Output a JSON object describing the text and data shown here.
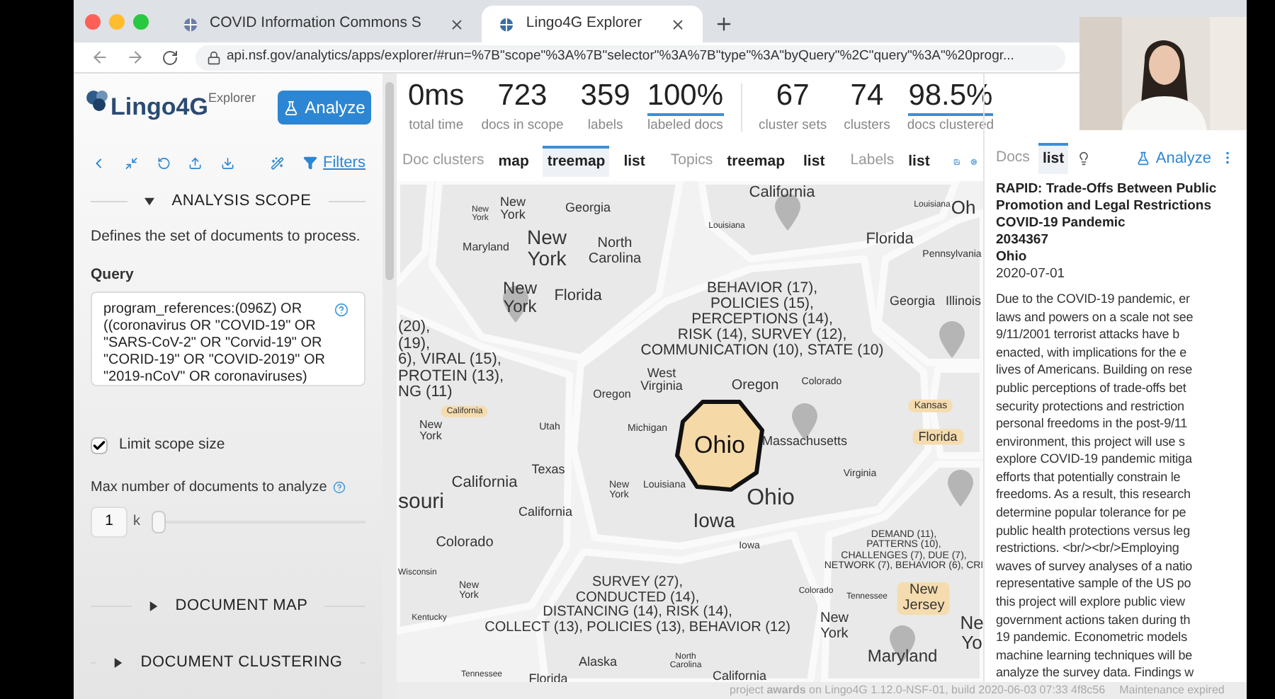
{
  "browser": {
    "tabs": [
      {
        "title": "COVID Information Commons S",
        "selected": false
      },
      {
        "title": "Lingo4G Explorer",
        "selected": true
      }
    ],
    "url": "api.nsf.gov/analytics/apps/explorer/#run=%7B\"scope\"%3A%7B\"selector\"%3A%7B\"type\"%3A\"byQuery\"%2C\"query\"%3A\"%20progr..."
  },
  "sidebar": {
    "logo": "Lingo4G",
    "logo_sup": "Explorer",
    "analyze": "Analyze",
    "filters": "Filters",
    "scope": {
      "title": "ANALYSIS SCOPE",
      "expanded": true,
      "description": "Defines the set of documents to process.",
      "query_label": "Query",
      "query": "program_references:(096Z) OR ((coronavirus OR \"COVID-19\" OR \"SARS-CoV-2\" OR \"Corvid-19\" OR \"CORID-19\" OR \"COVID-2019\" OR \"2019-nCoV\" OR coronaviruses)",
      "limit_label": "Limit scope size",
      "limit_checked": true,
      "max_label": "Max number of documents to analyze",
      "max_value": "1",
      "max_unit": "k",
      "level": 0
    },
    "sections": [
      {
        "title": "DOCUMENT MAP",
        "expanded": false
      },
      {
        "title": "DOCUMENT CLUSTERING",
        "expanded": false
      }
    ]
  },
  "stats": [
    {
      "value": "0ms",
      "label": "total time",
      "linked": false,
      "divider_before": false
    },
    {
      "value": "723",
      "label": "docs in scope",
      "linked": false,
      "divider_before": false
    },
    {
      "value": "359",
      "label": "labels",
      "linked": false,
      "divider_before": false
    },
    {
      "value": "100%",
      "label": "labeled docs",
      "linked": true,
      "divider_before": false
    },
    {
      "value": "67",
      "label": "cluster sets",
      "linked": false,
      "divider_before": true
    },
    {
      "value": "74",
      "label": "clusters",
      "linked": false,
      "divider_before": false
    },
    {
      "value": "98.5%",
      "label": "docs clustered",
      "linked": true,
      "divider_before": false
    }
  ],
  "views": [
    {
      "label": "Doc clusters",
      "options": [
        {
          "label": "map",
          "selected": false
        },
        {
          "label": "treemap",
          "selected": true
        },
        {
          "label": "list",
          "selected": false
        }
      ]
    },
    {
      "label": "Topics",
      "options": [
        {
          "label": "treemap",
          "selected": false
        },
        {
          "label": "list",
          "selected": false
        }
      ]
    },
    {
      "label": "Labels",
      "options": [
        {
          "label": "list",
          "selected": false
        }
      ]
    }
  ],
  "treemap": {
    "focus": "Ohio",
    "labels": [
      {
        "text": "New York",
        "highlighted": false
      },
      {
        "text": "New York",
        "highlighted": false
      },
      {
        "text": "Georgia",
        "highlighted": false
      },
      {
        "text": "Maryland",
        "highlighted": false
      },
      {
        "text": "New York",
        "highlighted": false
      },
      {
        "text": "North Carolina",
        "highlighted": false
      },
      {
        "text": "New York",
        "highlighted": false
      },
      {
        "text": "Florida",
        "highlighted": false
      },
      {
        "text": "California",
        "highlighted": false
      },
      {
        "text": "Louisiana",
        "highlighted": false
      },
      {
        "text": "Louisiana",
        "highlighted": false
      },
      {
        "text": "Oh",
        "highlighted": false
      },
      {
        "text": "Florida",
        "highlighted": false
      },
      {
        "text": "Pennsylvania",
        "highlighted": false
      },
      {
        "text": "Georgia",
        "highlighted": false
      },
      {
        "text": "Illinois",
        "highlighted": false
      },
      {
        "text": "BEHAVIOR (17),\nPOLICIES (15),\nPERCEPTIONS (14),\nRISK (14), SURVEY (12),\nCOMMUNICATION (10), STATE (10)",
        "highlighted": false
      },
      {
        "text": "(20),\n(19),\n6), VIRAL (15),\nPROTEIN (13),\nNG (11)",
        "highlighted": false
      },
      {
        "text": "West Virginia",
        "highlighted": false
      },
      {
        "text": "Oregon",
        "highlighted": false
      },
      {
        "text": "Oregon",
        "highlighted": false
      },
      {
        "text": "Colorado",
        "highlighted": false
      },
      {
        "text": "New York",
        "highlighted": false
      },
      {
        "text": "California",
        "highlighted": true
      },
      {
        "text": "Utah",
        "highlighted": false
      },
      {
        "text": "Michigan",
        "highlighted": false
      },
      {
        "text": "Massachusetts",
        "highlighted": false
      },
      {
        "text": "Kansas",
        "highlighted": true
      },
      {
        "text": "Florida",
        "highlighted": true
      },
      {
        "text": "California",
        "highlighted": false
      },
      {
        "text": "Texas",
        "highlighted": false
      },
      {
        "text": "souri",
        "highlighted": false
      },
      {
        "text": "California",
        "highlighted": false
      },
      {
        "text": "New York",
        "highlighted": false
      },
      {
        "text": "Louisiana",
        "highlighted": false
      },
      {
        "text": "Ohio",
        "highlighted": false
      },
      {
        "text": "Virginia",
        "highlighted": false
      },
      {
        "text": "Iowa",
        "highlighted": false
      },
      {
        "text": "Colorado",
        "highlighted": false
      },
      {
        "text": "Iowa",
        "highlighted": false
      },
      {
        "text": "Wisconsin",
        "highlighted": false
      },
      {
        "text": "DEMAND (11),\nPATTERNS (10),\nCHALLENGES (7), DUE (7),\nNETWORK (7), BEHAVIOR (6), CRI",
        "highlighted": false
      },
      {
        "text": "New York",
        "highlighted": false
      },
      {
        "text": "Kentucky",
        "highlighted": false
      },
      {
        "text": "SURVEY (27),\nCONDUCTED (14),\nDISTANCING (14), RISK (14),\nCOLLECT (13), POLICIES (13), BEHAVIOR (12)",
        "highlighted": false
      },
      {
        "text": "Colorado",
        "highlighted": false
      },
      {
        "text": "Tennessee",
        "highlighted": false
      },
      {
        "text": "New Jersey",
        "highlighted": true
      },
      {
        "text": "New York",
        "highlighted": false
      },
      {
        "text": "Ne Yo",
        "highlighted": false
      },
      {
        "text": "Alaska",
        "highlighted": false
      },
      {
        "text": "North Carolina",
        "highlighted": false
      },
      {
        "text": "Maryland",
        "highlighted": false
      },
      {
        "text": "Tennessee",
        "highlighted": false
      },
      {
        "text": "Florida",
        "highlighted": false
      },
      {
        "text": "California",
        "highlighted": false
      }
    ]
  },
  "docs_panel": {
    "label": "Docs",
    "options": [
      {
        "label": "list",
        "selected": true
      }
    ],
    "analyze": "Analyze",
    "title_lines": [
      "RAPID: Trade-Offs Between Public",
      "Promotion and Legal Restrictions",
      "COVID-19 Pandemic"
    ],
    "id": "2034367",
    "location": "Ohio",
    "date": "2020-07-01",
    "abstract_lines": [
      "Due to the COVID-19 pandemic, er",
      "laws and powers on a scale not see",
      "9/11/2001 terrorist attacks have b",
      "enacted, with implications for the e",
      "lives of Americans. Building on rese",
      "public perceptions of trade-offs bet",
      "security protections and restriction",
      "personal freedoms in the post-9/11",
      "environment, this project will use s",
      "explore COVID-19 pandemic mitiga",
      "efforts that potentially constrain le",
      "freedoms. As a result, this research",
      "determine popular tolerance for pe",
      "public health protections versus leg",
      "restrictions. <br/><br/>Employing",
      "waves of survey analyses of a natio",
      "representative sample of the US po",
      "this project will explore public view",
      "government actions taken during th",
      "19 pandemic. Econometric models",
      "machine learning techniques will be",
      "analyze the survey data. Findings w"
    ]
  },
  "footer": {
    "text": "project **awards** on Lingo4G 1.12.0-NSF-01, build 2020-06-03 07:33 4f8c56",
    "status": "Maintenance expired"
  }
}
